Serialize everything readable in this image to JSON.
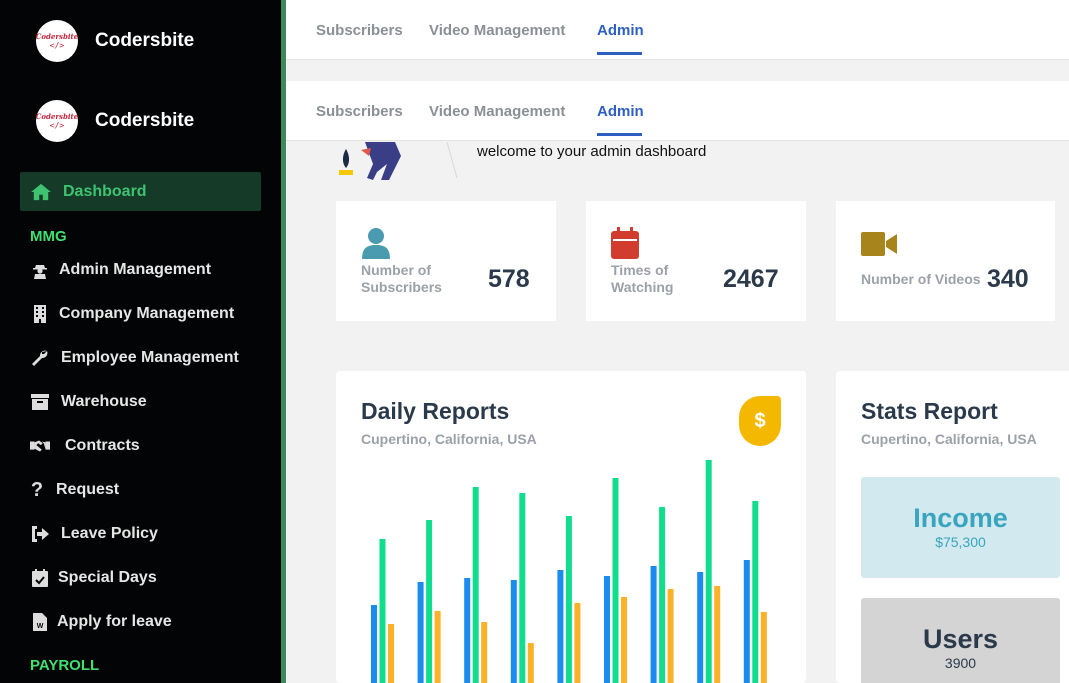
{
  "brand": {
    "name": "Codersbite",
    "logo_text": "Codersbite",
    "logo_code": "</>"
  },
  "sidebar": {
    "active": {
      "label": "Dashboard",
      "icon": "home-icon"
    },
    "section_mmg": "MMG",
    "items": [
      {
        "label": "Admin Management",
        "icon": "user-secret-icon"
      },
      {
        "label": "Company Management",
        "icon": "building-icon"
      },
      {
        "label": "Employee Management",
        "icon": "wrench-icon"
      },
      {
        "label": "Warehouse",
        "icon": "archive-icon"
      },
      {
        "label": "Contracts",
        "icon": "handshake-icon"
      },
      {
        "label": "Request",
        "icon": "question-icon"
      },
      {
        "label": "Leave Policy",
        "icon": "sign-out-icon"
      },
      {
        "label": "Special Days",
        "icon": "calendar-check-icon"
      },
      {
        "label": "Apply for leave",
        "icon": "word-file-icon"
      }
    ],
    "section_payroll": "PAYROLL"
  },
  "tabs": [
    {
      "label": "Subscribers"
    },
    {
      "label": "Video Management"
    },
    {
      "label": "Admin",
      "active": true
    }
  ],
  "welcome": "welcome to your admin dashboard",
  "stats": [
    {
      "label1": "Number of",
      "label2": "Subscribers",
      "value": "578",
      "icon": "user-icon",
      "color": "#4a9bb0"
    },
    {
      "label1": "Times of",
      "label2": "Watching",
      "value": "2467",
      "icon": "calendar-icon",
      "color": "#d23c2e"
    },
    {
      "label1": "Number of Videos",
      "label2": "",
      "value": "340",
      "icon": "video-camera-icon",
      "color": "#a8841c"
    }
  ],
  "daily": {
    "title": "Daily Reports",
    "subtitle": "Cupertino, California, USA",
    "icon": "dollar-icon",
    "symbol": "$"
  },
  "stats_report": {
    "title": "Stats Report",
    "subtitle": "Cupertino, California, USA",
    "income_label": "Income",
    "income_value": "$75,300",
    "users_label": "Users",
    "users_value": "3900"
  },
  "colors": {
    "blue": "#1a8cf0",
    "green": "#10de8e",
    "orange": "#fbb128",
    "accent": "#2e5fc2"
  },
  "chart_data": {
    "type": "bar",
    "ylim": [
      0,
      230
    ],
    "series": [
      {
        "values": [
          78,
          101,
          105,
          103,
          113,
          107,
          117,
          111,
          123
        ]
      },
      {
        "values": [
          144,
          163,
          196,
          190,
          167,
          205,
          176,
          223,
          182
        ]
      },
      {
        "values": [
          59,
          72,
          61,
          40,
          80,
          86,
          94,
          97,
          71
        ]
      }
    ]
  }
}
